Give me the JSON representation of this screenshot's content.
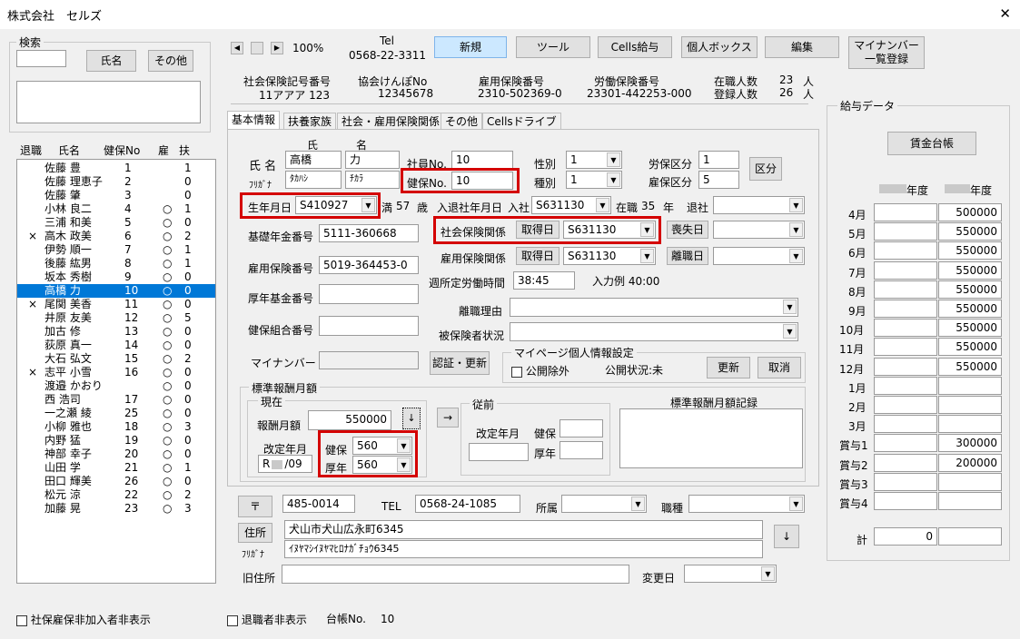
{
  "window": {
    "title": "株式会社　セルズ",
    "close": "✕"
  },
  "search": {
    "legend": "検索",
    "name_btn": "氏名",
    "other_btn": "その他"
  },
  "list": {
    "headers": [
      "退職",
      "氏名",
      "健保No",
      "雇",
      "扶"
    ],
    "rows": [
      {
        "ret": "",
        "name": "佐藤 豊",
        "no": "1",
        "koyo": "",
        "fu": "1"
      },
      {
        "ret": "",
        "name": "佐藤 理恵子",
        "no": "2",
        "koyo": "",
        "fu": "0"
      },
      {
        "ret": "",
        "name": "佐藤 肇",
        "no": "3",
        "koyo": "",
        "fu": "0"
      },
      {
        "ret": "",
        "name": "小林 良二",
        "no": "4",
        "koyo": "○",
        "fu": "1"
      },
      {
        "ret": "",
        "name": "三浦 和美",
        "no": "5",
        "koyo": "○",
        "fu": "0"
      },
      {
        "ret": "×",
        "name": "高木 政美",
        "no": "6",
        "koyo": "○",
        "fu": "2"
      },
      {
        "ret": "",
        "name": "伊勢 順一",
        "no": "7",
        "koyo": "○",
        "fu": "1"
      },
      {
        "ret": "",
        "name": "後藤 紘男",
        "no": "8",
        "koyo": "○",
        "fu": "1"
      },
      {
        "ret": "",
        "name": "坂本 秀樹",
        "no": "9",
        "koyo": "○",
        "fu": "0"
      },
      {
        "ret": "",
        "name": "高橋 力",
        "no": "10",
        "koyo": "○",
        "fu": "0",
        "sel": true
      },
      {
        "ret": "×",
        "name": "尾関 美香",
        "no": "11",
        "koyo": "○",
        "fu": "0"
      },
      {
        "ret": "",
        "name": "井原 友美",
        "no": "12",
        "koyo": "○",
        "fu": "5"
      },
      {
        "ret": "",
        "name": "加古 修",
        "no": "13",
        "koyo": "○",
        "fu": "0"
      },
      {
        "ret": "",
        "name": "荻原 真一",
        "no": "14",
        "koyo": "○",
        "fu": "0"
      },
      {
        "ret": "",
        "name": "大石 弘文",
        "no": "15",
        "koyo": "○",
        "fu": "2"
      },
      {
        "ret": "×",
        "name": "志平 小雪",
        "no": "16",
        "koyo": "○",
        "fu": "0"
      },
      {
        "ret": "",
        "name": "渡邉 かおり",
        "no": "",
        "koyo": "○",
        "fu": "0"
      },
      {
        "ret": "",
        "name": "西 浩司",
        "no": "17",
        "koyo": "○",
        "fu": "0"
      },
      {
        "ret": "",
        "name": "一之瀬 綾",
        "no": "25",
        "koyo": "○",
        "fu": "0"
      },
      {
        "ret": "",
        "name": "小柳 雅也",
        "no": "18",
        "koyo": "○",
        "fu": "3"
      },
      {
        "ret": "",
        "name": "内野 猛",
        "no": "19",
        "koyo": "○",
        "fu": "0"
      },
      {
        "ret": "",
        "name": "神部 幸子",
        "no": "20",
        "koyo": "○",
        "fu": "0"
      },
      {
        "ret": "",
        "name": "山田 学",
        "no": "21",
        "koyo": "○",
        "fu": "1"
      },
      {
        "ret": "",
        "name": "田口 輝美",
        "no": "26",
        "koyo": "○",
        "fu": "0"
      },
      {
        "ret": "",
        "name": "松元 涼",
        "no": "22",
        "koyo": "○",
        "fu": "2"
      },
      {
        "ret": "",
        "name": "加藤 晃",
        "no": "23",
        "koyo": "○",
        "fu": "3"
      }
    ]
  },
  "bottom": {
    "hide_uninsured": "社保雇保非加入者非表示",
    "hide_retired": "退職者非表示",
    "ledger_label": "台帳No.",
    "ledger_no": "10"
  },
  "toolbar": {
    "zoom": "100%",
    "tel_label": "Tel",
    "tel": "0568-22-3311",
    "new": "新規",
    "tool": "ツール",
    "cells_pay": "Cells給与",
    "personal_box": "個人ボックス",
    "edit": "編集",
    "mynumber": "マイナンバー一覧登録"
  },
  "company": {
    "shaho_label": "社会保険記号番号",
    "shaho": "11アアア 123",
    "kyokai_label": "協会けんぽNo",
    "kyokai": "12345678",
    "koyo_label": "雇用保険番号",
    "koyo": "2310-502369-0",
    "rodo_label": "労働保険番号",
    "rodo": "23301-442253-000",
    "zaishoku_label": "在職人数",
    "zaishoku": "23",
    "toroku_label": "登録人数",
    "toroku": "26",
    "unit": "人"
  },
  "tabs": [
    "基本情報",
    "扶養家族",
    "社会・雇用保険関係",
    "その他",
    "Cellsドライブ"
  ],
  "form": {
    "sei_label": "氏",
    "mei_label": "名",
    "name_label": "氏 名",
    "sei": "高橋",
    "mei": "力",
    "furigana_label": "ﾌﾘｶﾞﾅ",
    "sei_kana": "ﾀｶﾊｼ",
    "mei_kana": "ﾁｶﾗ",
    "shain_label": "社員No.",
    "shain": "10",
    "kenpo_label": "健保No.",
    "kenpo": "10",
    "seibetsu_label": "性別",
    "seibetsu": "1",
    "shubetsu_label": "種別",
    "shubetsu": "1",
    "rouho_label": "労保区分",
    "rouho": "1",
    "koho_label": "雇保区分",
    "koho": "5",
    "kubun_btn": "区分",
    "birth_label": "生年月日",
    "birth": "S410927",
    "age_unit": "満",
    "age": "57",
    "age_suffix": "歳",
    "nyutai_label": "入退社年月日",
    "nyusha_label": "入社",
    "nyusha": "S631130",
    "zaishoku_label": "在職",
    "zaishoku": "35",
    "year": "年",
    "taisha_label": "退社",
    "kiso_label": "基礎年金番号",
    "kiso": "5111-360668",
    "koyo_label": "雇用保険番号",
    "koyo": "5019-364453-0",
    "kosei_label": "厚年基金番号",
    "kumiai_label": "健保組合番号",
    "mynumber_label": "マイナンバー",
    "shakai_label": "社会保険関係",
    "shutoku_btn": "取得日",
    "shakai_date": "S631130",
    "soshitsu_btn": "喪失日",
    "koyo_rel_label": "雇用保険関係",
    "koyo_date": "S631130",
    "rishoku_btn": "離職日",
    "weekly_label": "週所定労働時間",
    "weekly": "38:45",
    "example": "入力例 40:00",
    "rishoku_reason": "離職理由",
    "hihokensha": "被保険者状況",
    "auth_btn": "認証・更新",
    "mypage_legend": "マイページ個人情報設定",
    "public_exclude": "公開除外",
    "public_status": "公開状況:未",
    "update_btn": "更新",
    "cancel_btn": "取消",
    "std_legend": "標準報酬月額",
    "current_legend": "現在",
    "hoshu_label": "報酬月額",
    "hoshu": "550000",
    "kaitei_label": "改定年月",
    "kaitei_year": "R",
    "kaitei_month": "/09",
    "kenpo_std_label": "健保",
    "kenpo_std": "560",
    "kosei_std_label": "厚年",
    "kosei_std": "560",
    "arrow": "→",
    "jyuzen_legend": "従前",
    "jyuzen_kaitei": "改定年月",
    "jyuzen_kenpo": "健保",
    "jyuzen_kosei": "厚年",
    "record_label": "標準報酬月額記録",
    "zip_btn": "〒",
    "zip": "485-0014",
    "tel_label": "TEL",
    "tel": "0568-24-1085",
    "shozoku_label": "所属",
    "shokushu_label": "職種",
    "address_btn": "住所",
    "address": "犬山市犬山広永町6345",
    "address_kana_label": "ﾌﾘｶﾞﾅ",
    "address_kana": "ｲﾇﾔﾏｼｲﾇﾔﾏﾋﾛﾅｶﾞﾁｮｳ6345",
    "down_arrow": "↓",
    "old_address_label": "旧住所",
    "change_date_label": "変更日"
  },
  "salary": {
    "legend": "給与データ",
    "ledger_btn": "賃金台帳",
    "year_label": "年度",
    "rows": [
      {
        "label": "4月",
        "v": "500000"
      },
      {
        "label": "5月",
        "v": "550000"
      },
      {
        "label": "6月",
        "v": "550000"
      },
      {
        "label": "7月",
        "v": "550000"
      },
      {
        "label": "8月",
        "v": "550000"
      },
      {
        "label": "9月",
        "v": "550000"
      },
      {
        "label": "10月",
        "v": "550000"
      },
      {
        "label": "11月",
        "v": "550000"
      },
      {
        "label": "12月",
        "v": "550000"
      },
      {
        "label": "1月",
        "v": ""
      },
      {
        "label": "2月",
        "v": ""
      },
      {
        "label": "3月",
        "v": ""
      },
      {
        "label": "賞与1",
        "v": "300000"
      },
      {
        "label": "賞与2",
        "v": "200000"
      },
      {
        "label": "賞与3",
        "v": ""
      },
      {
        "label": "賞与4",
        "v": ""
      }
    ],
    "total_label": "計",
    "total": "0"
  }
}
